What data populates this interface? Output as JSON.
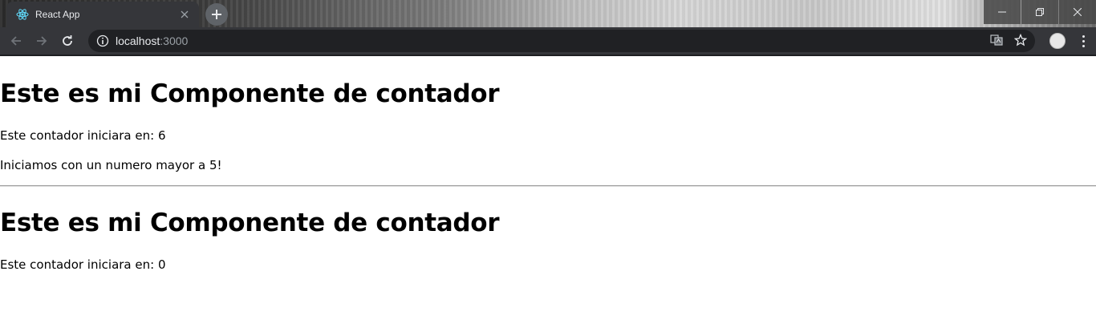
{
  "browser": {
    "tab_title": "React App",
    "url_host": "localhost",
    "url_port": ":3000",
    "icons": [
      "react-favicon",
      "close-icon",
      "plus-icon",
      "minimize-icon",
      "restore-icon",
      "window-close-icon",
      "back-arrow-icon",
      "forward-arrow-icon",
      "reload-icon",
      "info-icon",
      "translate-icon",
      "star-icon",
      "avatar",
      "kebab-menu-icon"
    ]
  },
  "page": {
    "counters": [
      {
        "heading": "Este es mi Componente de contador",
        "start_text": "Este contador iniciara en: 6",
        "message": "Iniciamos con un numero mayor a 5!"
      },
      {
        "heading": "Este es mi Componente de contador",
        "start_text": "Este contador iniciara en: 0"
      }
    ]
  },
  "colors": {
    "tab_bg": "#35363a",
    "toolbar_bg": "#35363a",
    "omnibox_bg": "#202124",
    "react_blue": "#61dafb"
  }
}
